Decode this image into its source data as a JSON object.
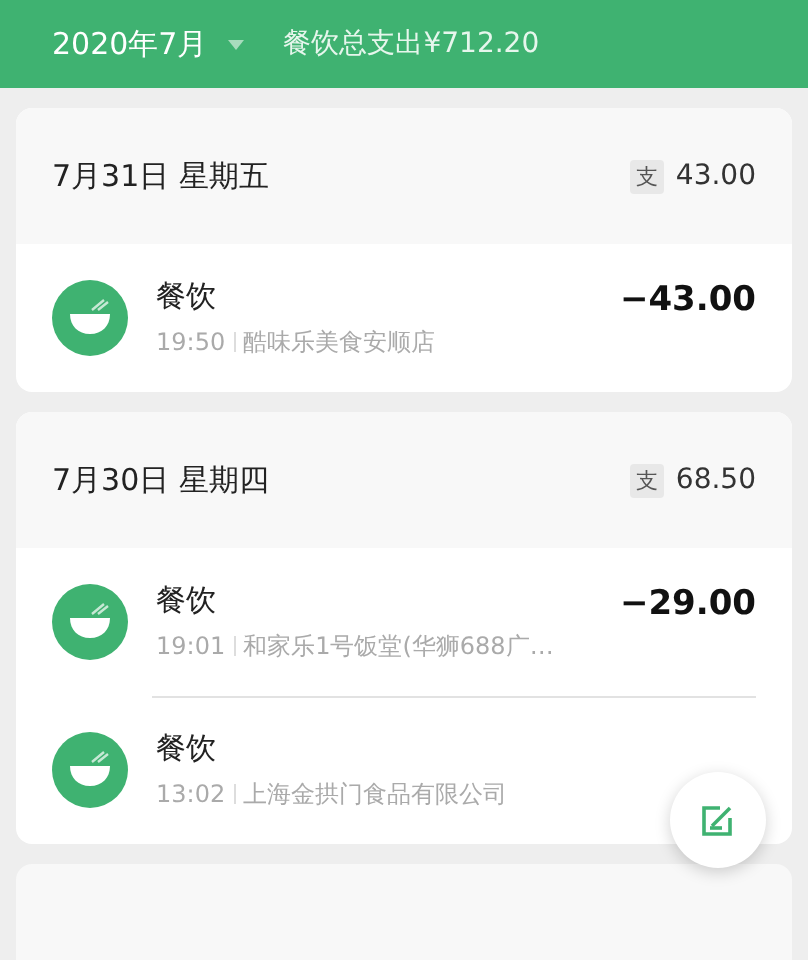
{
  "header": {
    "month": "2020年7月",
    "summary": "餐饮总支出¥712.20"
  },
  "days": [
    {
      "date": "7月31日 星期五",
      "badge": "支",
      "total": "43.00",
      "entries": [
        {
          "category": "餐饮",
          "time": "19:50",
          "merchant": "酷味乐美食安顺店",
          "amount": "−43.00"
        }
      ]
    },
    {
      "date": "7月30日 星期四",
      "badge": "支",
      "total": "68.50",
      "entries": [
        {
          "category": "餐饮",
          "time": "19:01",
          "merchant": "和家乐1号饭堂(华狮688广…",
          "amount": "−29.00"
        },
        {
          "category": "餐饮",
          "time": "13:02",
          "merchant": "上海金拱门食品有限公司"
        }
      ]
    }
  ]
}
